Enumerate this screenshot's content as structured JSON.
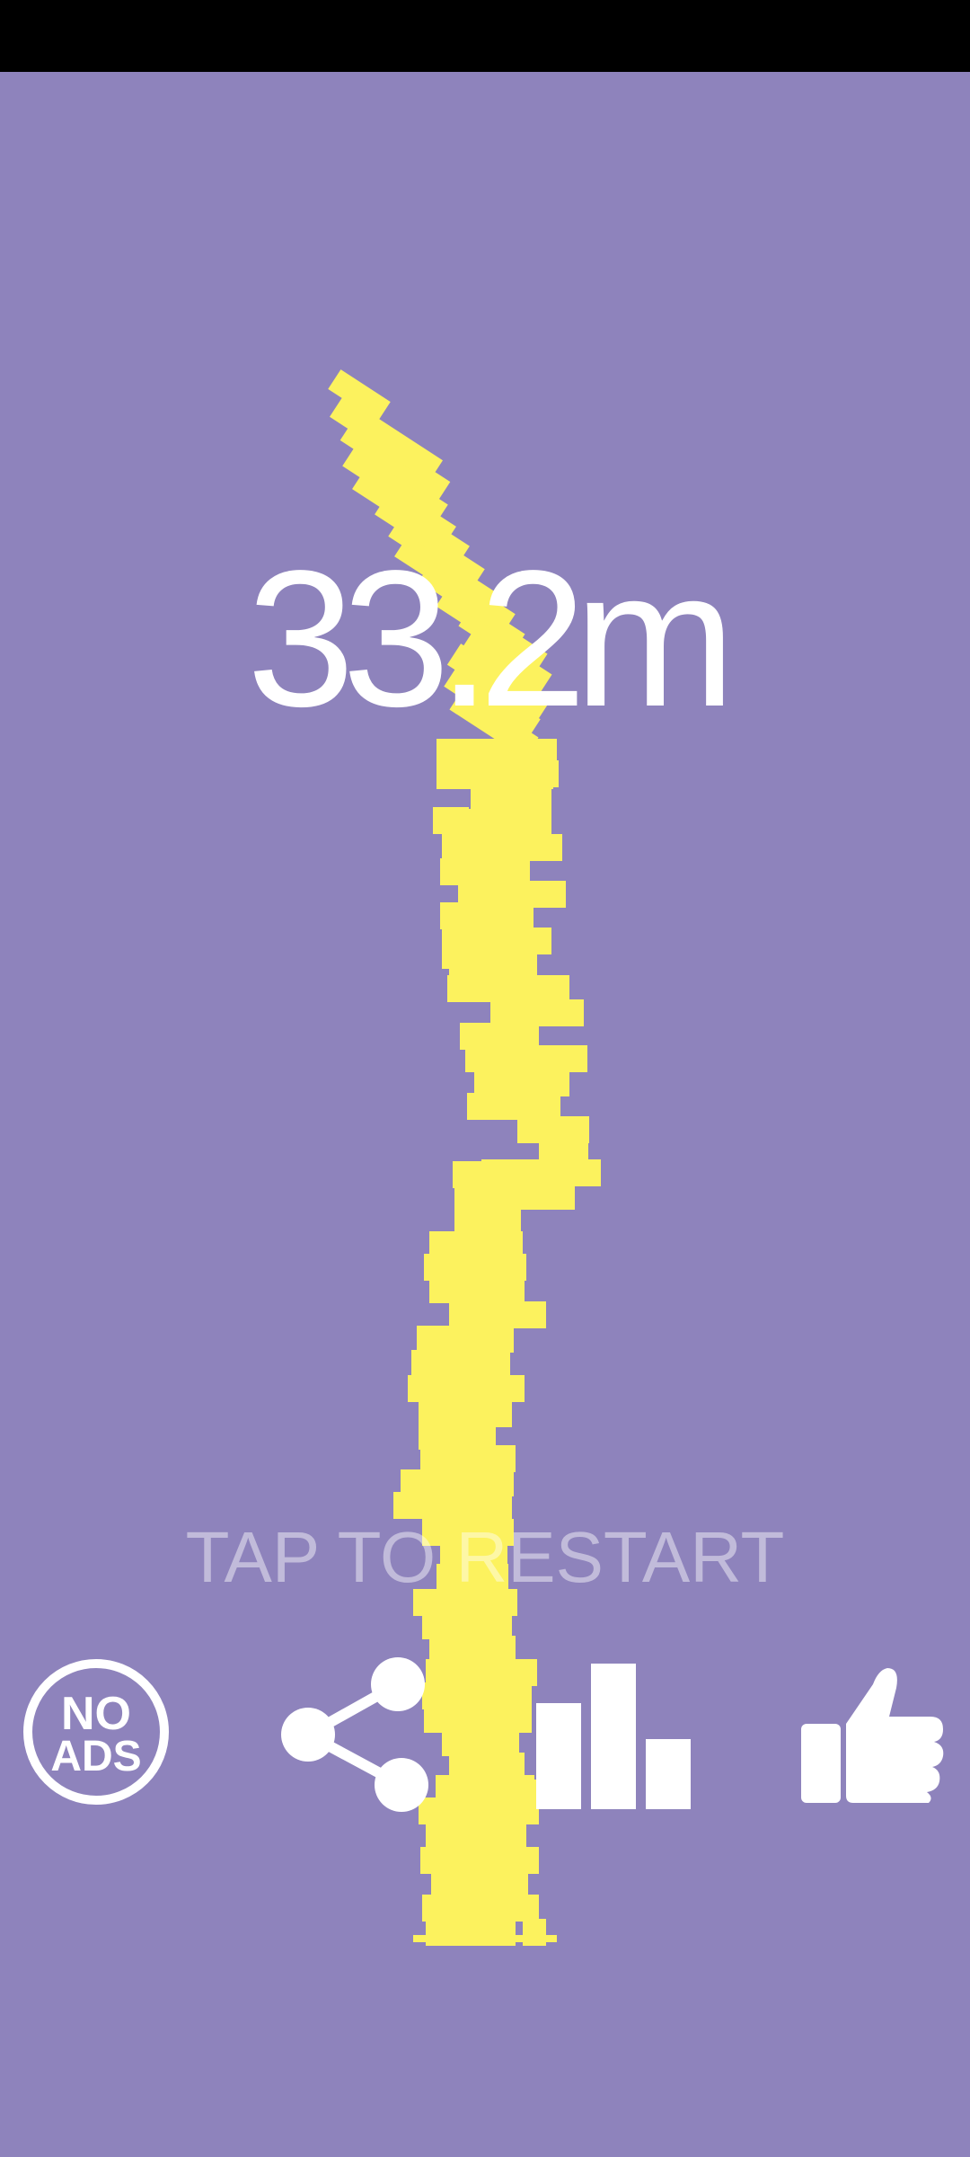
{
  "colors": {
    "background": "#8e83bc",
    "status_bar": "#000000",
    "block": "#fcf25e",
    "text": "#ffffff",
    "icon": "#ffffff"
  },
  "game": {
    "height_score": "33.2m",
    "restart_prompt": "TAP TO RESTART"
  },
  "buttons": {
    "no_ads": {
      "line1": "NO",
      "line2": "ADS",
      "icon": "no-ads-icon"
    },
    "share": {
      "icon": "share-icon"
    },
    "leaderboard": {
      "icon": "bar-chart-icon"
    },
    "like": {
      "icon": "thumbs-up-icon"
    }
  }
}
